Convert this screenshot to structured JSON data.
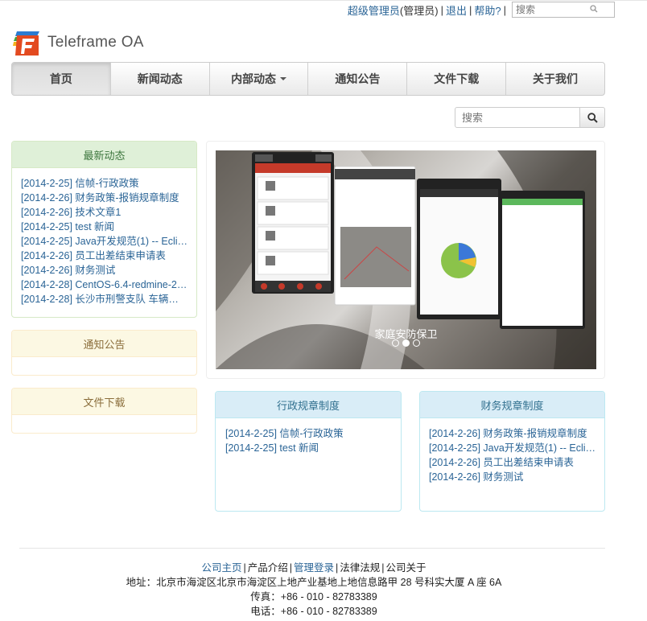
{
  "topbar": {
    "user_link": "超级管理员",
    "user_role": "(管理员)",
    "logout": "退出",
    "help": "帮助?",
    "search_placeholder": "搜索"
  },
  "brand": {
    "name": "Teleframe OA"
  },
  "nav": [
    {
      "label": "首页",
      "active": true
    },
    {
      "label": "新闻动态"
    },
    {
      "label": "内部动态",
      "dropdown": true
    },
    {
      "label": "通知公告"
    },
    {
      "label": "文件下载"
    },
    {
      "label": "关于我们"
    }
  ],
  "main_search": {
    "placeholder": "搜索"
  },
  "latest": {
    "title": "最新动态",
    "items": [
      "[2014-2-25] 信帧-行政政策",
      "[2014-2-26] 财务政策-报销规章制度",
      "[2014-2-26] 技术文章1",
      "[2014-2-25] test 新闻",
      "[2014-2-25]  Java开发规范(1) -- Eclipse...",
      "[2014-2-26] 员工出差结束申请表",
      "[2014-2-26] 财务测试",
      "[2014-2-28] CentOS-6.4-redmine-2.4...",
      "[2014-2-28] 长沙市刑警支队 车辆比对..."
    ]
  },
  "notice": {
    "title": "通知公告"
  },
  "downloads": {
    "title": "文件下载"
  },
  "carousel": {
    "caption": "家庭安防保卫",
    "slide_count": 3,
    "active_index": 1
  },
  "admin_rules": {
    "title": "行政规章制度",
    "items": [
      "[2014-2-25]  信帧-行政政策",
      "[2014-2-25]  test 新闻"
    ]
  },
  "finance_rules": {
    "title": "财务规章制度",
    "items": [
      "[2014-2-26]  财务政策-报销规章制度",
      "[2014-2-25]    Java开发规范(1) -- Eclipse...",
      "[2014-2-26]  员工出差结束申请表",
      "[2014-2-26]  财务测试"
    ]
  },
  "footer": {
    "links": [
      "公司主页",
      "产品介绍",
      "管理登录",
      "法律法规",
      "公司关于"
    ],
    "address": "地址：北京市海淀区北京市海淀区上地产业基地上地信息路甲 28 号科实大厦 A 座 6A",
    "fax": "传真：+86 - 010 - 82783389",
    "phone": "电话：+86 - 010 - 82783389"
  },
  "colors": {
    "link": "#2a6496",
    "green_header": "#dff0d8",
    "yellow_header": "#fcf8e3",
    "blue_header": "#d9edf7"
  }
}
